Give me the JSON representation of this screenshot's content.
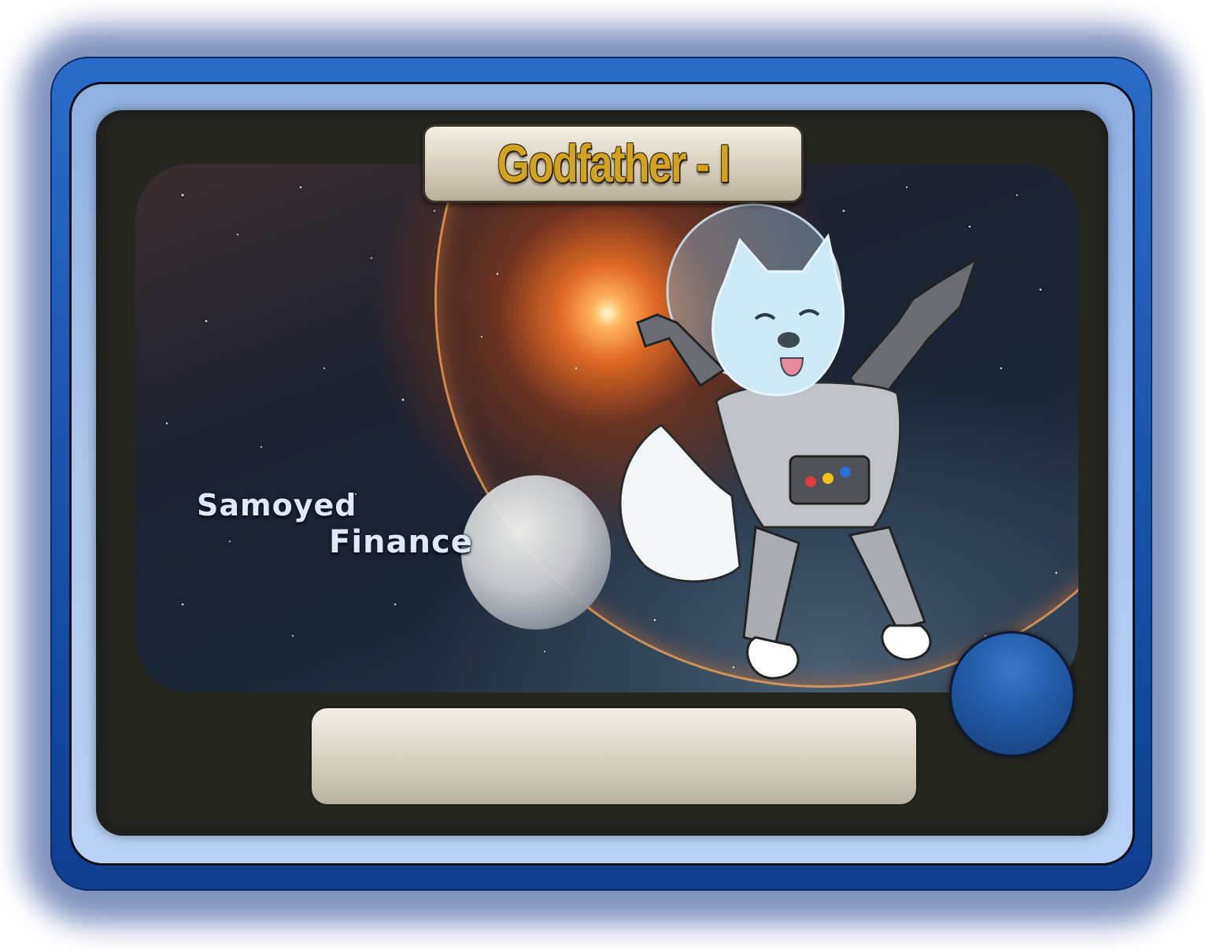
{
  "card": {
    "title": "Godfather - I",
    "brand_line1": "Samoyed",
    "brand_line2": "Finance"
  },
  "colors": {
    "frame_blue": "#1752aa",
    "inner_blue": "#a9c5ee",
    "screen_dark": "#262621",
    "title_gold": "#d2a321",
    "orb_blue": "#225aa5"
  },
  "icons": {
    "mascot": "astronaut-samoyed-icon",
    "orb": "blue-orb-icon"
  }
}
